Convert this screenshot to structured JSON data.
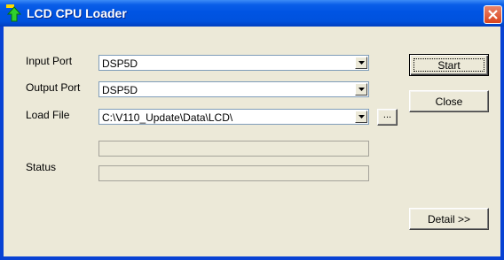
{
  "window": {
    "title": "LCD CPU Loader",
    "icon": "upload-arrow-icon",
    "close_icon": "close-icon"
  },
  "form": {
    "input_port": {
      "label": "Input Port",
      "value": "DSP5D"
    },
    "output_port": {
      "label": "Output Port",
      "value": "DSP5D"
    },
    "load_file": {
      "label": "Load File",
      "value": "C:\\V110_Update\\Data\\LCD\\",
      "browse_label": "..."
    },
    "status": {
      "label": "Status"
    }
  },
  "buttons": {
    "start": "Start",
    "close": "Close",
    "detail": "Detail >>"
  },
  "colors": {
    "titlebar": "#0054e3",
    "client_background": "#ece9d8",
    "close_button": "#d9441d"
  }
}
